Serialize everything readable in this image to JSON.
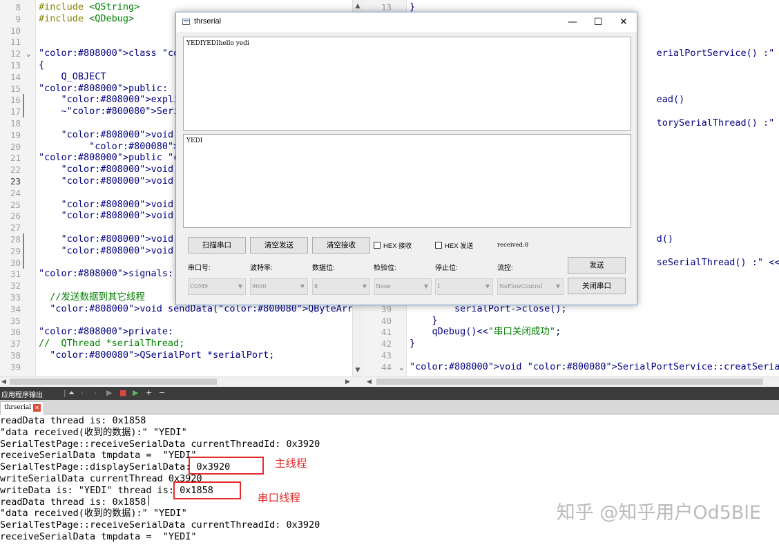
{
  "left_editor": {
    "lines": [
      {
        "n": "8",
        "code": "#include <QString>"
      },
      {
        "n": "9",
        "code": "#include <QDebug>"
      },
      {
        "n": "10",
        "code": ""
      },
      {
        "n": "11",
        "code": ""
      },
      {
        "n": "12",
        "code": "class SerialPortService"
      },
      {
        "n": "13",
        "code": "{"
      },
      {
        "n": "14",
        "code": "    Q_OBJECT"
      },
      {
        "n": "15",
        "code": "public:"
      },
      {
        "n": "16",
        "code": "    explicit SerialPortS"
      },
      {
        "n": "17",
        "code": "    ~SerialPortService()"
      },
      {
        "n": "18",
        "code": ""
      },
      {
        "n": "19",
        "code": "    void setSerialPara(Q"
      },
      {
        "n": "20",
        "code": "         QSerialPort::St"
      },
      {
        "n": "21",
        "code": "public slots:"
      },
      {
        "n": "22",
        "code": "    void creatSerialThre"
      },
      {
        "n": "23",
        "code": "    void creatSerialPort"
      },
      {
        "n": "24",
        "code": ""
      },
      {
        "n": "25",
        "code": "    void readData();  //"
      },
      {
        "n": "26",
        "code": "    void writeData(QByte"
      },
      {
        "n": "27",
        "code": ""
      },
      {
        "n": "28",
        "code": "    void destorySerialTh"
      },
      {
        "n": "29",
        "code": "    void closeSerialThre"
      },
      {
        "n": "30",
        "code": ""
      },
      {
        "n": "31",
        "code": "signals:"
      },
      {
        "n": "32",
        "code": ""
      },
      {
        "n": "33",
        "code": "  //发送数据到其它线程"
      },
      {
        "n": "34",
        "code": "  void sendData(QByteArray data);"
      },
      {
        "n": "35",
        "code": ""
      },
      {
        "n": "36",
        "code": "private:"
      },
      {
        "n": "37",
        "code": "//  QThread *serialThread;"
      },
      {
        "n": "38",
        "code": "  QSerialPort *serialPort;"
      },
      {
        "n": "39",
        "code": ""
      }
    ]
  },
  "right_editor": {
    "lines": [
      {
        "n": "13",
        "code": "}"
      },
      {
        "n": "",
        "code": ""
      },
      {
        "n": "",
        "code": ""
      },
      {
        "n": "",
        "code": ""
      },
      {
        "n": "",
        "code": "                                            erialPortService() :\" <<"
      },
      {
        "n": "",
        "code": ""
      },
      {
        "n": "",
        "code": ""
      },
      {
        "n": "",
        "code": ""
      },
      {
        "n": "",
        "code": "                                            ead()"
      },
      {
        "n": "",
        "code": ""
      },
      {
        "n": "",
        "code": "                                            torySerialThread() :\" <<"
      },
      {
        "n": "",
        "code": ""
      },
      {
        "n": "",
        "code": ""
      },
      {
        "n": "",
        "code": ""
      },
      {
        "n": "",
        "code": ""
      },
      {
        "n": "",
        "code": ""
      },
      {
        "n": "",
        "code": ""
      },
      {
        "n": "",
        "code": ""
      },
      {
        "n": "",
        "code": ""
      },
      {
        "n": "",
        "code": ""
      },
      {
        "n": "",
        "code": "                                            d()"
      },
      {
        "n": "",
        "code": ""
      },
      {
        "n": "",
        "code": "                                            seSerialThread() :\" << QT"
      },
      {
        "n": "",
        "code": ""
      },
      {
        "n": "",
        "code": ""
      },
      {
        "n": "",
        "code": ""
      },
      {
        "n": "39",
        "code": "        serialPort->close();"
      },
      {
        "n": "40",
        "code": "    }"
      },
      {
        "n": "41",
        "code": "    qDebug()<<\"串口关闭成功\";"
      },
      {
        "n": "42",
        "code": "}"
      },
      {
        "n": "43",
        "code": ""
      },
      {
        "n": "44",
        "code": "void SerialPortService::creatSerialThread()"
      }
    ]
  },
  "dialog": {
    "title": "thrserial",
    "recv_text": "YEDIYEDIhello yedi",
    "send_text": "YEDI",
    "buttons": {
      "scan": "扫描串口",
      "clear_send": "清空发送",
      "clear_recv": "清空接收",
      "send": "发送",
      "close_port": "关闭串口"
    },
    "hex_recv": "HEX 接收",
    "hex_send": "HEX 发送",
    "received": "received:8",
    "labels": {
      "port": "串口号:",
      "baud": "波特率:",
      "databits": "数据位:",
      "parity": "检验位:",
      "stopbits": "停止位:",
      "flow": "流控:"
    },
    "combos": {
      "port": "COM9",
      "baud": "9600",
      "databits": "8",
      "parity": "None",
      "stopbits": "1",
      "flow": "NoFlowControl"
    }
  },
  "output_pane": {
    "toolbar_label": "应用程序输出",
    "tab_label": "thrserial",
    "lines": [
      "readData thread is: 0x1858",
      "\"data received(收到的数据):\" \"YEDI\"",
      "SerialTestPage::receiveSerialData currentThreadId: 0x3920",
      "receiveSerialData tmpdata =  \"YEDI\"",
      "SerialTestPage::displaySerialData: 0x3920",
      "writeSerialData currentThread 0x3920",
      "writeData is: \"YEDI\" thread is: 0x1858",
      "readData thread is: 0x1858",
      "\"data received(收到的数据):\" \"YEDI\"",
      "SerialTestPage::receiveSerialData currentThreadId: 0x3920",
      "receiveSerialData tmpdata =  \"YEDI\""
    ],
    "annotation_main": "主线程",
    "annotation_serial": "串口线程"
  },
  "watermark": "知乎 @知乎用户Od5BlE",
  "colors": {
    "keyword": "#808000",
    "type": "#800080",
    "comment": "#008000",
    "string": "#008000",
    "annotation": "#e32b2b"
  },
  "icons": {
    "fold": "chevron-down-icon",
    "window_min": "minimize-icon",
    "window_max": "maximize-icon",
    "window_close": "close-icon",
    "tab_close": "close-icon"
  }
}
